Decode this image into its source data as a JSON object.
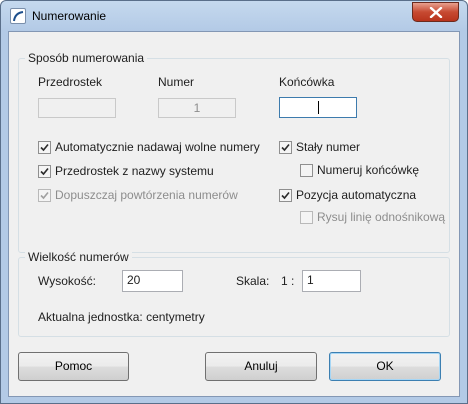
{
  "window": {
    "title": "Numerowanie"
  },
  "numbering": {
    "group_label": "Sposób numerowania",
    "prefix_label": "Przedrostek",
    "number_label": "Numer",
    "suffix_label": "Końcówka",
    "prefix_value": "",
    "number_value": "1",
    "suffix_value": "",
    "auto_free_numbers": {
      "label": "Automatycznie nadawaj wolne numery",
      "checked": true
    },
    "prefix_from_system": {
      "label": "Przedrostek z nazwy systemu",
      "checked": true
    },
    "allow_duplicates": {
      "label": "Dopuszczaj powtórzenia numerów",
      "checked": true,
      "disabled": true
    },
    "fixed_number": {
      "label": "Stały numer",
      "checked": true
    },
    "number_suffix": {
      "label": "Numeruj końcówkę",
      "checked": false
    },
    "auto_position": {
      "label": "Pozycja automatyczna",
      "checked": true
    },
    "draw_leader": {
      "label": "Rysuj linię odnośnikową",
      "checked": false,
      "disabled": true
    }
  },
  "size": {
    "group_label": "Wielkość numerów",
    "height_label": "Wysokość:",
    "height_value": "20",
    "scale_label": "Skala:",
    "scale_prefix": "1 :",
    "scale_value": "1",
    "unit_text": "Aktualna jednostka: centymetry"
  },
  "buttons": {
    "help": "Pomoc",
    "cancel": "Anuluj",
    "ok": "OK"
  }
}
